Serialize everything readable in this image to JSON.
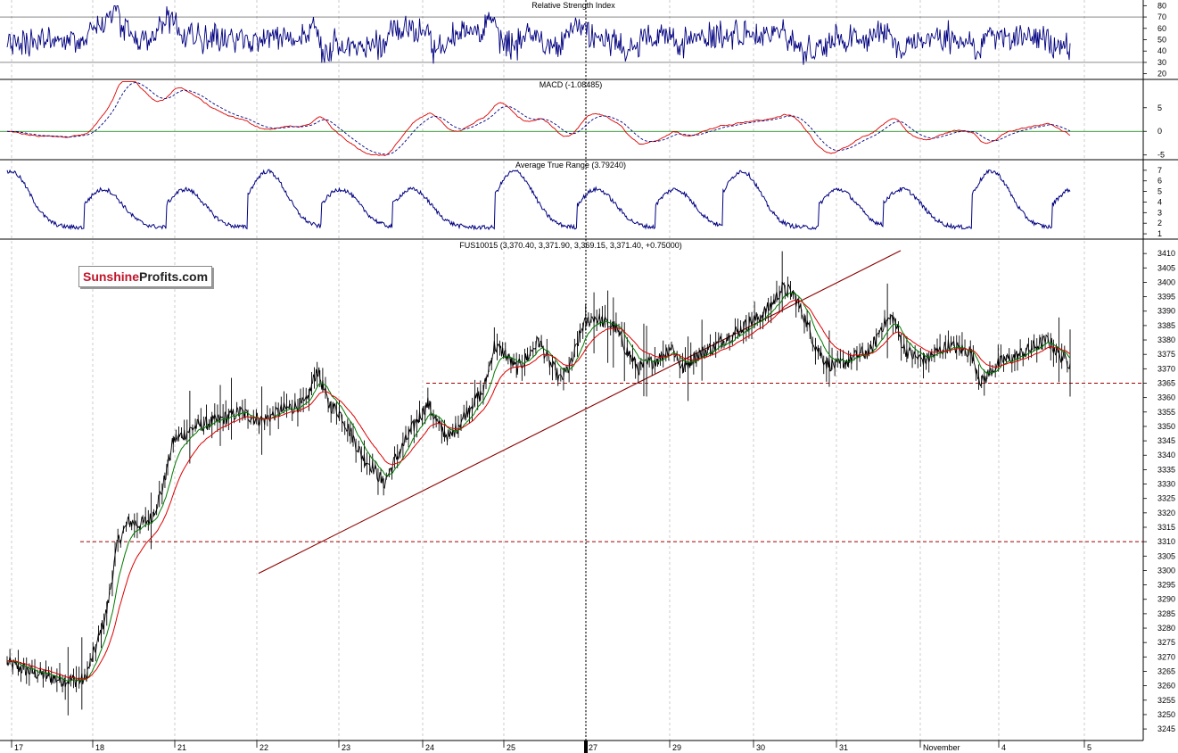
{
  "brand": {
    "part1": "Sunshine",
    "part2": "Profits.com"
  },
  "chart_data": {
    "type": "line",
    "x_axis": {
      "labels": [
        "17",
        "18",
        "21",
        "22",
        "23",
        "24",
        "25",
        "27",
        "29",
        "30",
        "31",
        "November",
        "4",
        "5"
      ]
    },
    "panels": {
      "rsi": {
        "title": "Relative Strength Index",
        "ylim": [
          15,
          85
        ],
        "ticks": [
          20,
          30,
          40,
          50,
          60,
          70,
          80
        ],
        "levels": [
          30,
          70
        ]
      },
      "macd": {
        "title": "MACD (-1.08485)",
        "ylim": [
          -6,
          11
        ],
        "ticks": [
          -5,
          0,
          5
        ],
        "zero": 0
      },
      "atr": {
        "title": "Average True Range (3.79240)",
        "ylim": [
          0.5,
          8
        ],
        "ticks": [
          1,
          2,
          3,
          4,
          5,
          6,
          7
        ]
      },
      "price": {
        "title": "FUS10015 (3,370.40, 3,371.90, 3,369.15, 3,371.40, +0.75000)",
        "ylim": [
          3241,
          3415
        ],
        "ticks": [
          3245,
          3250,
          3255,
          3260,
          3265,
          3270,
          3275,
          3280,
          3285,
          3290,
          3295,
          3300,
          3305,
          3310,
          3315,
          3320,
          3325,
          3330,
          3335,
          3340,
          3345,
          3350,
          3355,
          3360,
          3365,
          3370,
          3375,
          3380,
          3385,
          3390,
          3395,
          3400,
          3405,
          3410
        ],
        "support_levels": [
          3310,
          3365
        ],
        "trendline": {
          "start": {
            "x": "22",
            "y": 3299
          },
          "end": {
            "x": "30",
            "y": 3411
          }
        },
        "price_anchors": [
          [
            0,
            3268
          ],
          [
            2,
            3265
          ],
          [
            5,
            3262
          ],
          [
            7,
            3262
          ],
          [
            8,
            3273
          ],
          [
            9,
            3286
          ],
          [
            10,
            3310
          ],
          [
            11,
            3317
          ],
          [
            12,
            3316
          ],
          [
            13,
            3318
          ],
          [
            14,
            3328
          ],
          [
            15,
            3345
          ],
          [
            17,
            3350
          ],
          [
            19,
            3352
          ],
          [
            21,
            3355
          ],
          [
            23,
            3352
          ],
          [
            25,
            3356
          ],
          [
            27,
            3358
          ],
          [
            28,
            3370
          ],
          [
            29,
            3358
          ],
          [
            30,
            3355
          ],
          [
            31,
            3348
          ],
          [
            32,
            3340
          ],
          [
            33,
            3336
          ],
          [
            34,
            3330
          ],
          [
            35,
            3338
          ],
          [
            36,
            3345
          ],
          [
            37,
            3352
          ],
          [
            38,
            3358
          ],
          [
            39,
            3350
          ],
          [
            40,
            3346
          ],
          [
            41,
            3352
          ],
          [
            42,
            3358
          ],
          [
            43,
            3362
          ],
          [
            44,
            3378
          ],
          [
            45,
            3375
          ],
          [
            46,
            3370
          ],
          [
            47,
            3374
          ],
          [
            48,
            3380
          ],
          [
            49,
            3372
          ],
          [
            50,
            3366
          ],
          [
            51,
            3372
          ],
          [
            52,
            3385
          ],
          [
            53,
            3388
          ],
          [
            54,
            3386
          ],
          [
            55,
            3384
          ],
          [
            56,
            3376
          ],
          [
            57,
            3370
          ],
          [
            58,
            3372
          ],
          [
            59,
            3374
          ],
          [
            60,
            3378
          ],
          [
            61,
            3370
          ],
          [
            62,
            3374
          ],
          [
            63,
            3376
          ],
          [
            64,
            3378
          ],
          [
            65,
            3381
          ],
          [
            66,
            3383
          ],
          [
            67,
            3386
          ],
          [
            68,
            3388
          ],
          [
            69,
            3392
          ],
          [
            70,
            3398
          ],
          [
            71,
            3396
          ],
          [
            72,
            3388
          ],
          [
            73,
            3378
          ],
          [
            74,
            3372
          ],
          [
            75,
            3371
          ],
          [
            76,
            3373
          ],
          [
            77,
            3375
          ],
          [
            78,
            3376
          ],
          [
            79,
            3385
          ],
          [
            80,
            3388
          ],
          [
            81,
            3377
          ],
          [
            82,
            3374
          ],
          [
            83,
            3373
          ],
          [
            84,
            3376
          ],
          [
            85,
            3378
          ],
          [
            86,
            3377
          ],
          [
            87,
            3376
          ],
          [
            88,
            3365
          ],
          [
            89,
            3370
          ],
          [
            90,
            3373
          ],
          [
            91,
            3374
          ],
          [
            92,
            3376
          ],
          [
            93,
            3378
          ],
          [
            94,
            3380
          ],
          [
            95,
            3375
          ],
          [
            96,
            3372
          ]
        ]
      }
    },
    "colors": {
      "price": "#000000",
      "ema_fast": "#007a00",
      "ema_slow": "#dd0000",
      "indicator": "#000080",
      "trendline": "#8b0000",
      "support": "#a00000"
    }
  }
}
